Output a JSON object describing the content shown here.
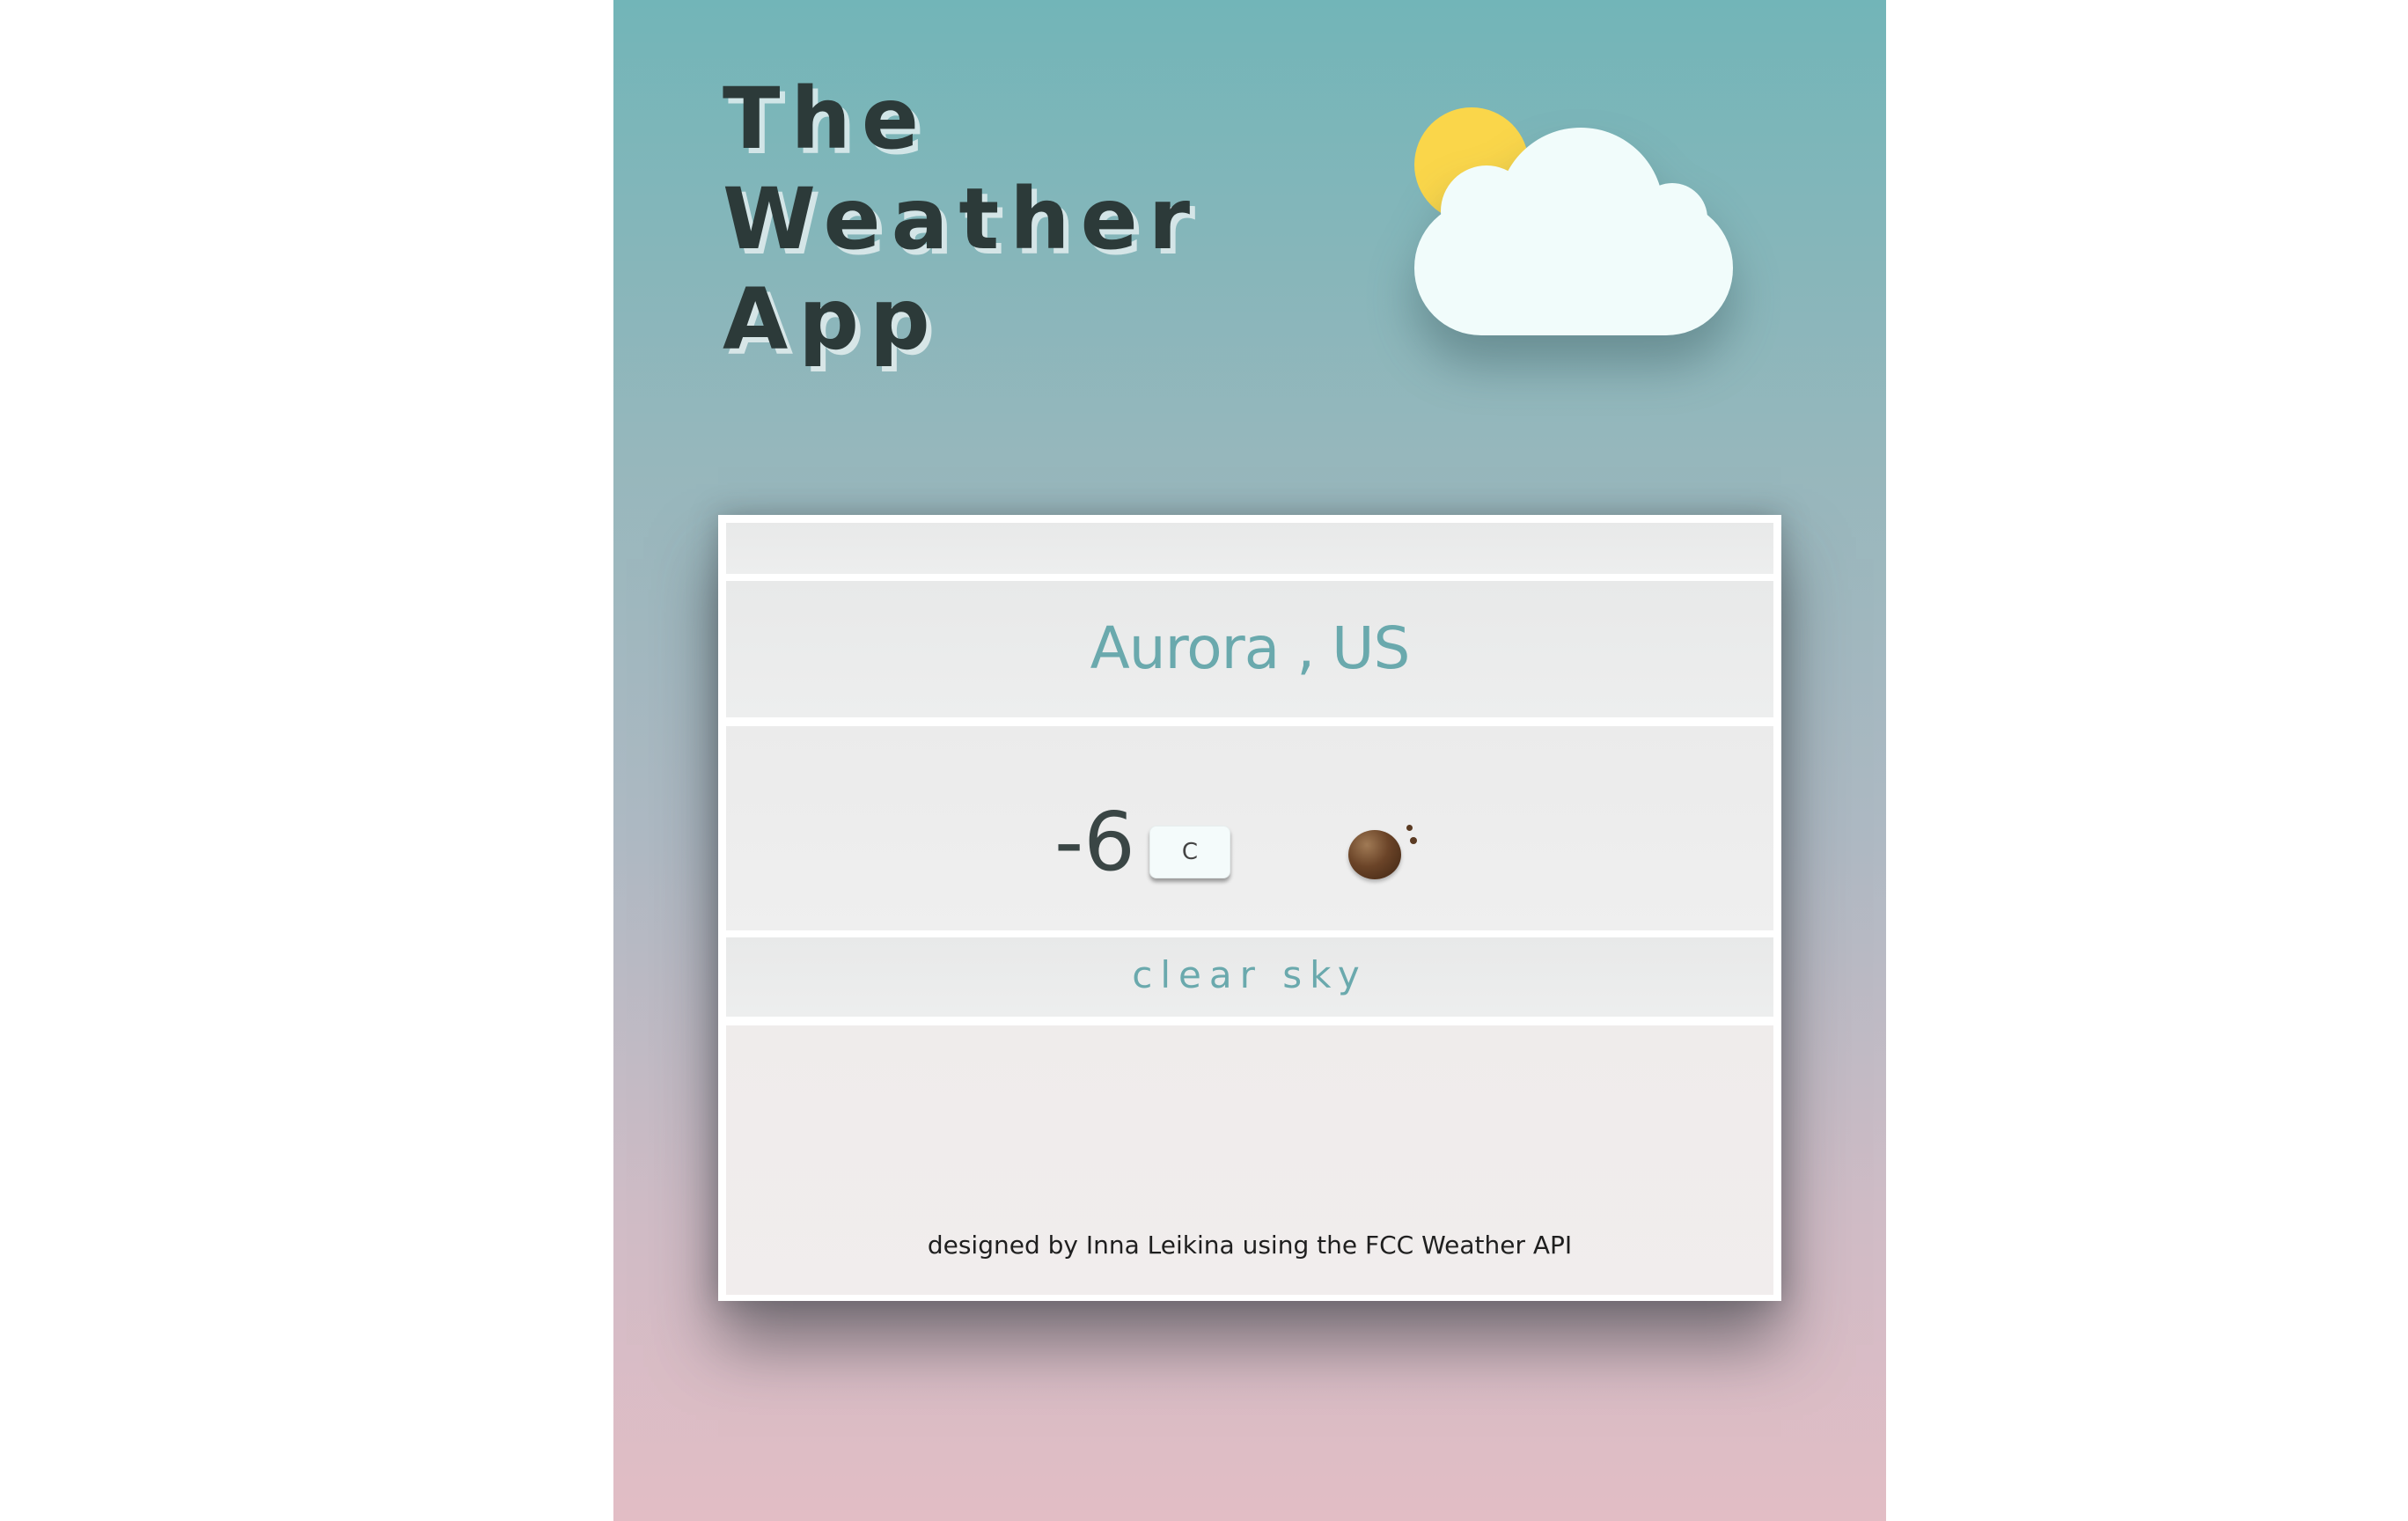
{
  "header": {
    "title_lines": [
      "The",
      "Weather",
      "App"
    ]
  },
  "hero": {
    "icon": "sun-behind-cloud-icon"
  },
  "weather": {
    "location": "Aurora , US",
    "temperature": "-6",
    "unit_button_label": "C",
    "condition_icon": "clear-sky-icon",
    "description": "clear sky"
  },
  "footer": {
    "credit": "designed by Inna Leikina using the FCC Weather API"
  },
  "colors": {
    "gradient_top": "#72b5b8",
    "gradient_bottom": "#e2bdc5",
    "accent_text": "#6aa9ad",
    "title_text": "#2c3a39",
    "sun": "#fad64a",
    "cloud": "#f1fcfb"
  }
}
